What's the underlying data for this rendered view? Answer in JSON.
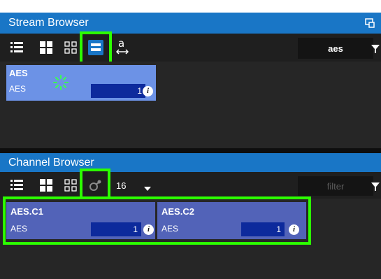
{
  "stream_browser": {
    "title": "Stream Browser",
    "filter_value": "aes",
    "tiles": [
      {
        "title": "AES",
        "subtitle": "AES",
        "value": "1"
      }
    ]
  },
  "channel_browser": {
    "title": "Channel Browser",
    "channel_count": "16",
    "filter_placeholder": "filter",
    "tiles": [
      {
        "title": "AES.C1",
        "subtitle": "AES",
        "value": "1"
      },
      {
        "title": "AES.C2",
        "subtitle": "AES",
        "value": "1"
      }
    ]
  },
  "icons": {
    "window": "popout-window-icon",
    "list": "list-view-icon",
    "grid_large": "grid-large-icon",
    "grid_small": "grid-small-icon",
    "tile_view": "tile-view-icon",
    "text_width": "text-width-icon",
    "filter": "filter-icon",
    "link": "link-icon",
    "dropdown": "dropdown-caret-icon",
    "info": "info-icon",
    "loading": "loading-spinner-icon"
  },
  "colors": {
    "header_blue": "#1976c6",
    "highlight_green": "#2cff00",
    "stream_tile": "#6c92e6",
    "channel_tile": "#5263b8",
    "value_field": "#0d2a9c"
  }
}
